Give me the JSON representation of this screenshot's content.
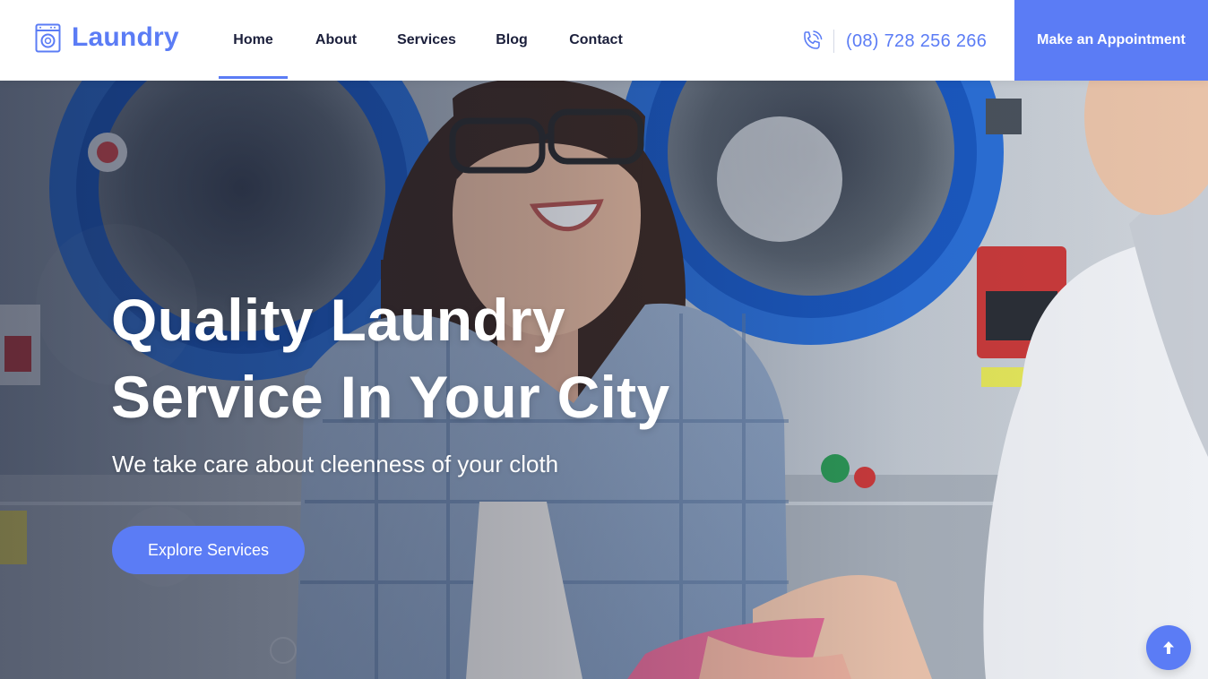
{
  "brand": {
    "name": "Laundry",
    "logo_icon": "washing-machine-icon",
    "accent_color": "#5b7cf5"
  },
  "nav": {
    "items": [
      {
        "label": "Home",
        "active": true
      },
      {
        "label": "About",
        "active": false
      },
      {
        "label": "Services",
        "active": false
      },
      {
        "label": "Blog",
        "active": false
      },
      {
        "label": "Contact",
        "active": false
      }
    ]
  },
  "contact": {
    "phone_icon": "phone-icon",
    "phone": "(08) 728 256 266"
  },
  "cta": {
    "label": "Make an Appointment"
  },
  "hero": {
    "title_line1": "Quality Laundry",
    "title_line2": "Service In Your City",
    "subtitle": "We take care about cleenness of your cloth",
    "button_label": "Explore Services",
    "background": "photo of smiling woman in a laundromat holding pink cloth"
  },
  "scroll_top": {
    "icon": "arrow-up-icon"
  }
}
